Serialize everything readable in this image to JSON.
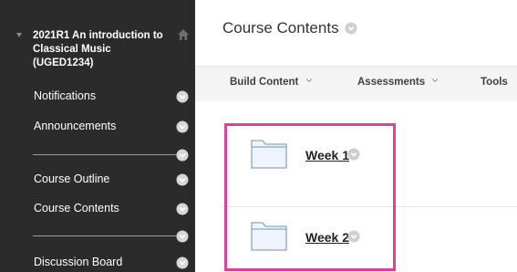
{
  "sidebar": {
    "course_title": "2021R1 An introduction to Classical Music (UGED1234)",
    "items": [
      {
        "label": "Notifications"
      },
      {
        "label": "Announcements"
      },
      {
        "label": "Course Outline"
      },
      {
        "label": "Course Contents"
      },
      {
        "label": "Discussion Board"
      }
    ]
  },
  "main": {
    "page_title": "Course Contents",
    "toolbar": [
      {
        "label": "Build Content"
      },
      {
        "label": "Assessments"
      },
      {
        "label": "Tools"
      }
    ],
    "folders": [
      {
        "label": "Week 1"
      },
      {
        "label": "Week 2"
      }
    ]
  },
  "colors": {
    "sidebar_bg": "#2b2b2b",
    "highlight": "#e0409c",
    "toolbar_bg": "#f4f4f4",
    "chevron_circle": "#cfcfcf"
  },
  "icons": [
    "collapse-arrow-icon",
    "home-icon",
    "chevron-down-icon",
    "folder-icon"
  ]
}
